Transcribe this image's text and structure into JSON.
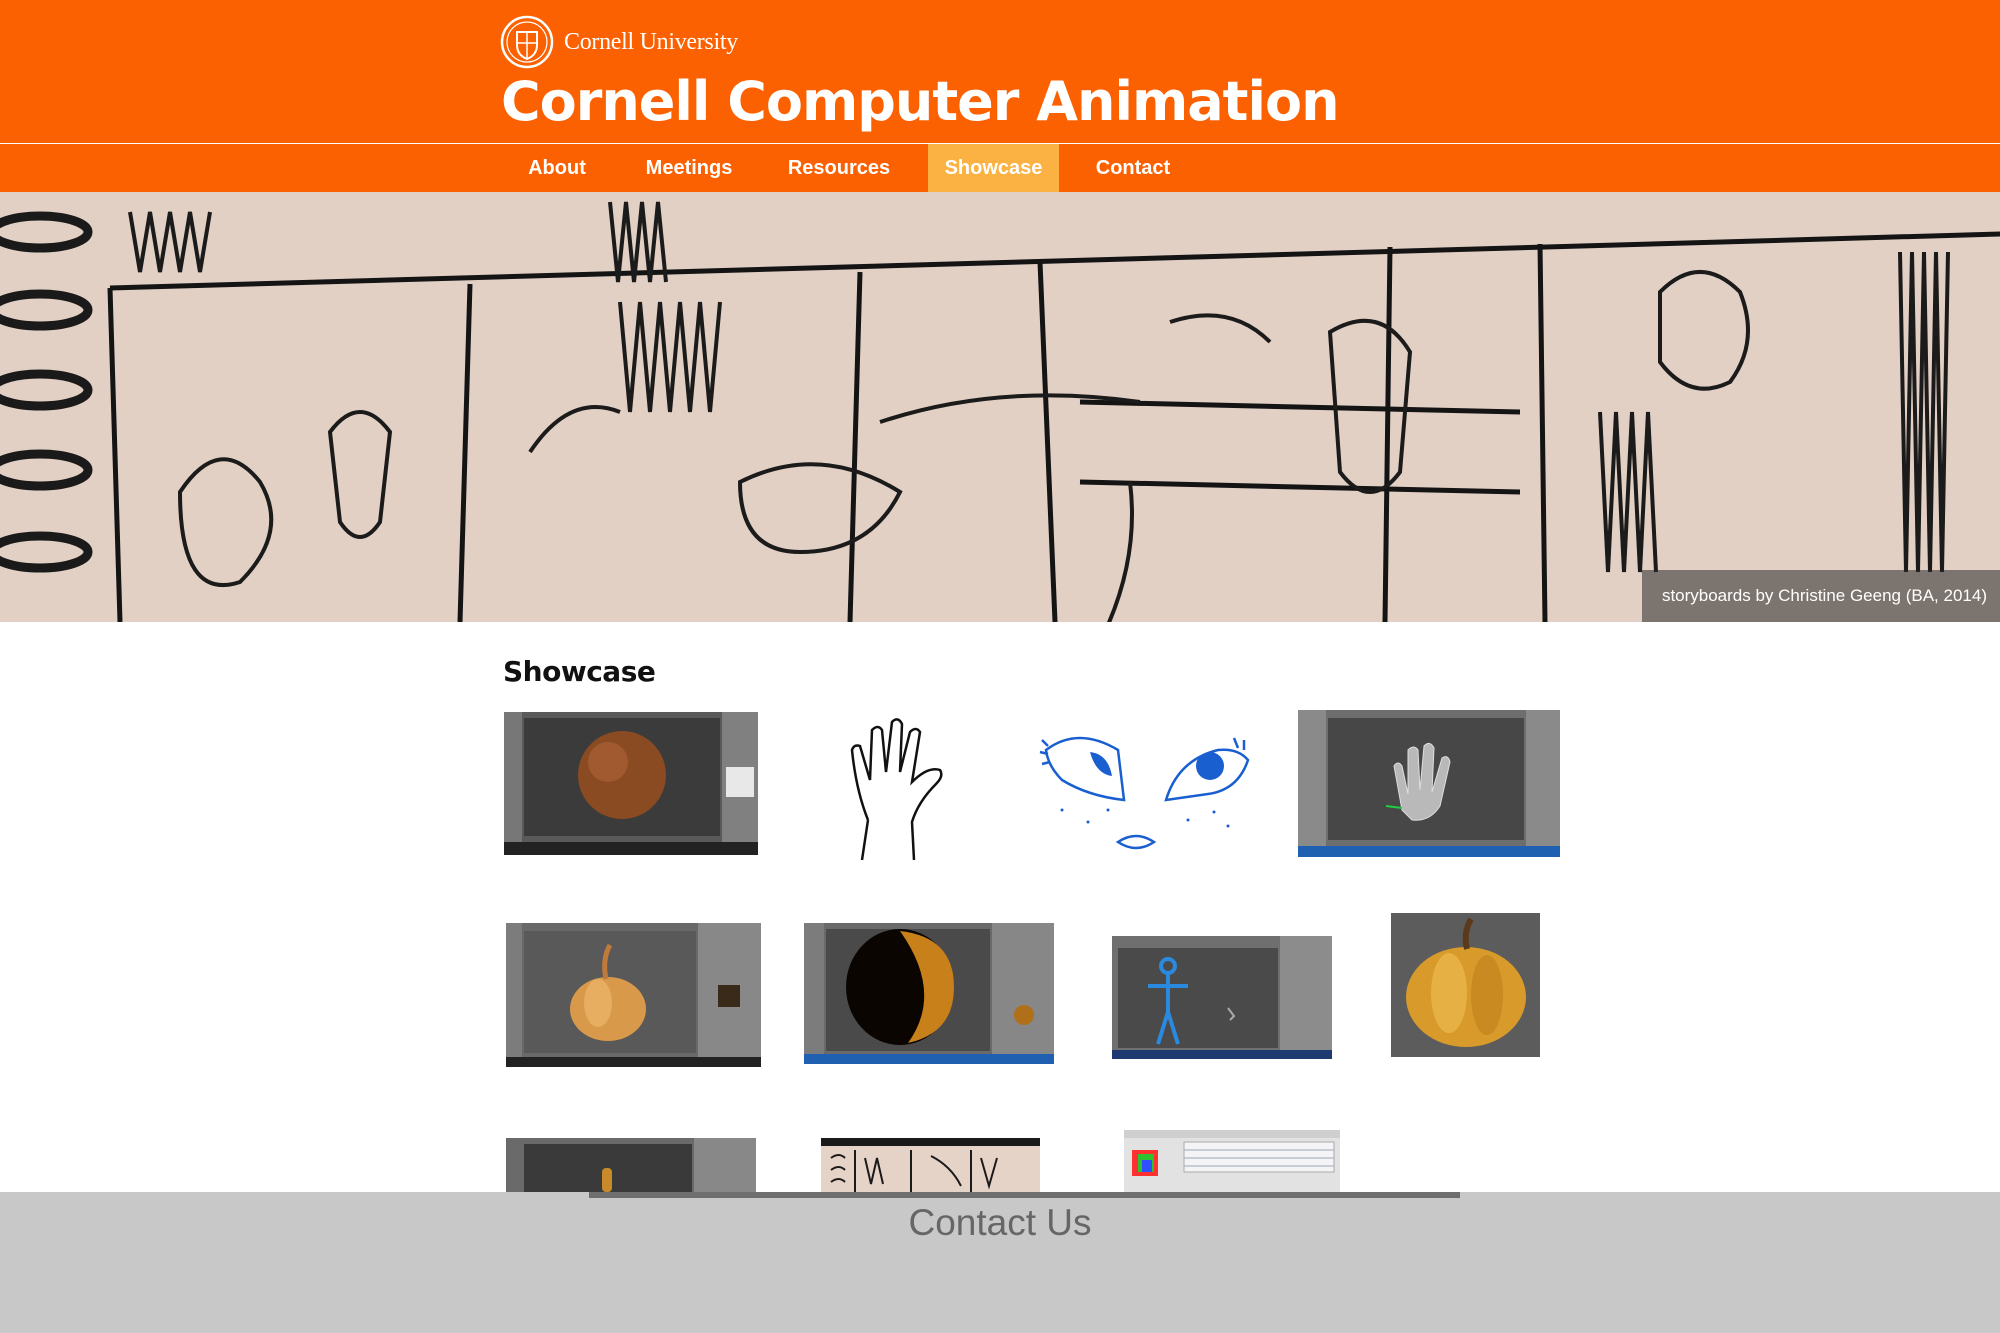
{
  "header": {
    "university": "Cornell University",
    "title": "Cornell Computer Animation"
  },
  "nav": {
    "items": [
      {
        "label": "About",
        "active": false
      },
      {
        "label": "Meetings",
        "active": false
      },
      {
        "label": "Resources",
        "active": false
      },
      {
        "label": "Showcase",
        "active": true
      },
      {
        "label": "Contact",
        "active": false
      }
    ]
  },
  "banner": {
    "caption": "storyboards by Christine Geeng (BA, 2014)"
  },
  "showcase": {
    "title": "Showcase",
    "thumbnails": [
      "blender-coconut-screenshot",
      "hand-sketch",
      "cartoon-eyes-sketch",
      "blender-hand-model-screenshot",
      "blender-pumpkin-screenshot",
      "blender-pumpkin-closeup-screenshot",
      "blender-rigged-figure-screenshot",
      "pumpkin-render",
      "blender-stem-screenshot",
      "storyboard-photo",
      "flash-animation-screenshot"
    ]
  },
  "footer": {
    "title": "Contact Us"
  },
  "colors": {
    "brand_orange": "#fb6100",
    "nav_active": "#fcb243",
    "footer_gray": "#c8c8c8"
  }
}
